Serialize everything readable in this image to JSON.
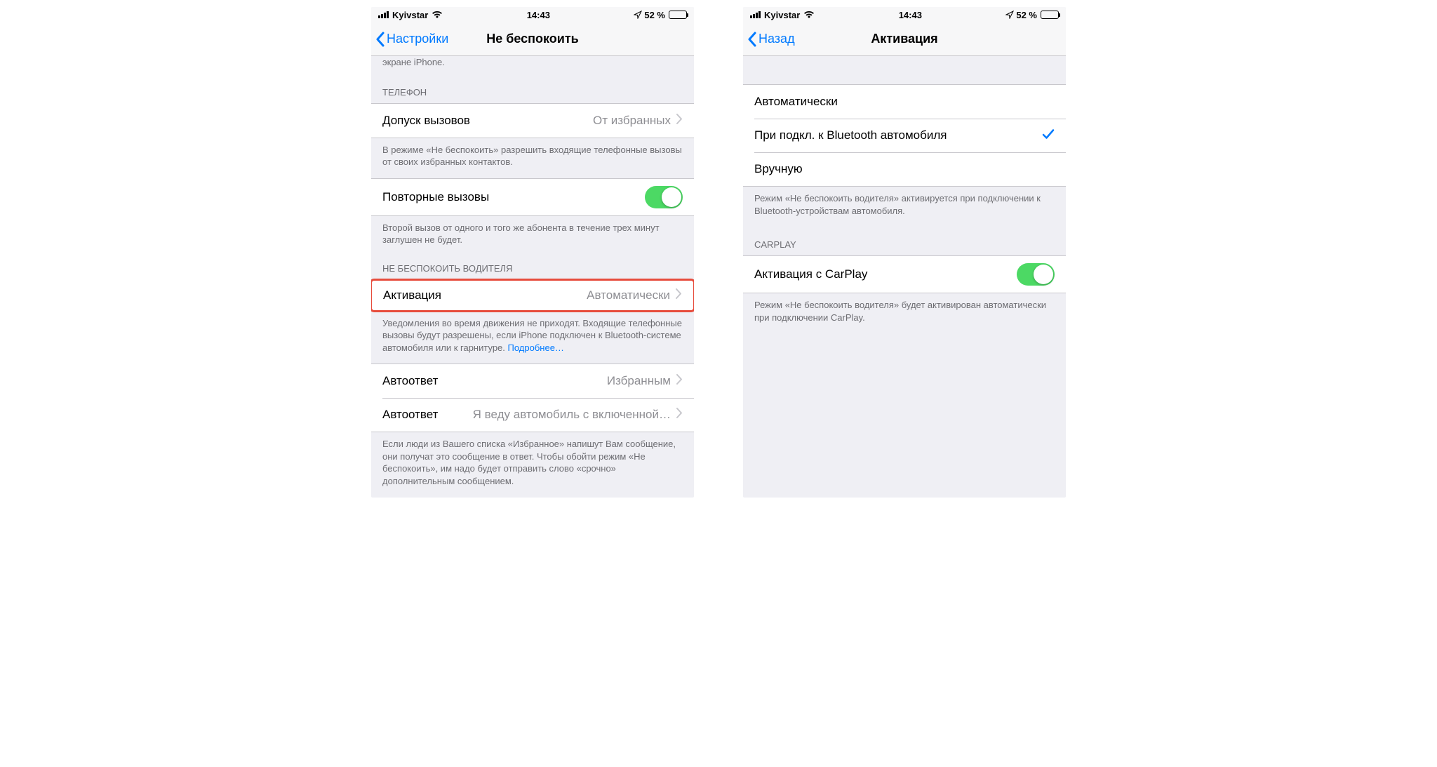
{
  "status": {
    "carrier": "Kyivstar",
    "time": "14:43",
    "battery_pct": "52 %",
    "battery_fill_pct": 52
  },
  "screen1": {
    "back_label": "Настройки",
    "title": "Не беспокоить",
    "truncated_top": "экране iPhone.",
    "sec_phone_header": "ТЕЛЕФОН",
    "allow_calls_label": "Допуск вызовов",
    "allow_calls_value": "От избранных",
    "allow_calls_footer": "В режиме «Не беспокоить» разрешить входящие телефонные вызовы от своих избранных контактов.",
    "repeat_calls_label": "Повторные вызовы",
    "repeat_calls_footer": "Второй вызов от одного и того же абонента в течение трех минут заглушен не будет.",
    "driver_header": "НЕ БЕСПОКОИТЬ ВОДИТЕЛЯ",
    "activation_label": "Активация",
    "activation_value": "Автоматически",
    "activation_footer_text": "Уведомления во время движения не приходят. Входящие телефонные вызовы будут разрешены, если iPhone подключен к Bluetooth-системе автомобиля или к гарнитуре. ",
    "activation_footer_link": "Подробнее…",
    "autoreply1_label": "Автоответ",
    "autoreply1_value": "Избранным",
    "autoreply2_label": "Автоответ",
    "autoreply2_value": "Я веду автомобиль с включенной…",
    "autoreply_footer": "Если люди из Вашего списка «Избранное» напишут Вам сообщение, они получат это сообщение в ответ. Чтобы обойти режим «Не беспокоить», им надо будет отправить слово «срочно» дополнительным сообщением."
  },
  "screen2": {
    "back_label": "Назад",
    "title": "Активация",
    "opt_auto": "Автоматически",
    "opt_bt": "При подкл. к Bluetooth автомобиля",
    "opt_manual": "Вручную",
    "opt_footer": "Режим «Не беспокоить водителя» активируется при подключении к Bluetooth-устройствам автомобиля.",
    "carplay_header": "CARPLAY",
    "carplay_label": "Активация с CarPlay",
    "carplay_footer": "Режим «Не беспокоить водителя» будет активирован автоматически при подключении CarPlay."
  }
}
